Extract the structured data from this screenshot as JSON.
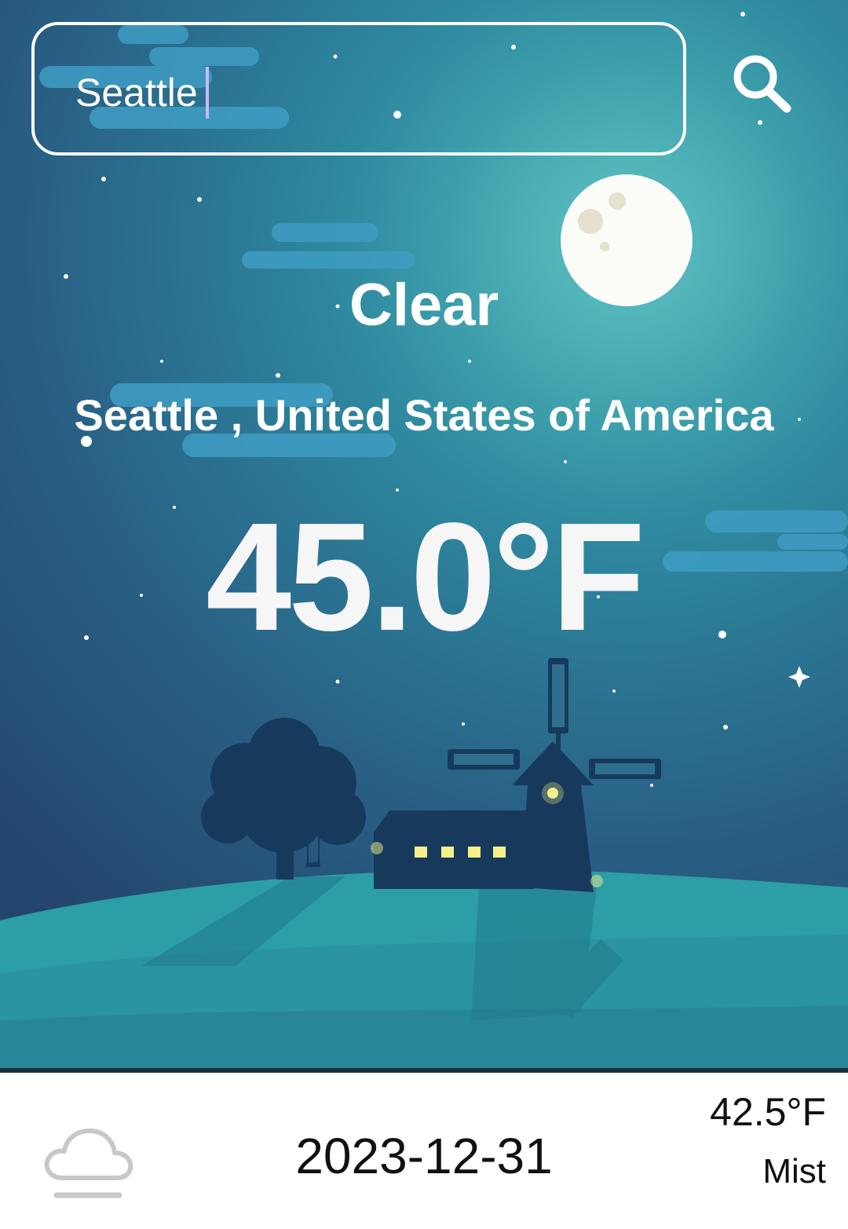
{
  "search": {
    "value": "Seattle"
  },
  "current": {
    "condition": "Clear",
    "location": "Seattle , United States of America",
    "temperature": "45.0°F"
  },
  "forecast": [
    {
      "icon": "cloud-icon",
      "date": "2023-12-31",
      "temperature": "42.5°F",
      "condition": "Mist"
    }
  ],
  "icons": {
    "search": "search-icon"
  },
  "colors": {
    "sky_light": "#5fc0c4",
    "sky_dark": "#24466e",
    "hill": "#2fa5ac",
    "silhouette": "#173a5c",
    "window_light": "#f5f08a",
    "text_light": "#ffffff",
    "text_dark": "#111111"
  }
}
